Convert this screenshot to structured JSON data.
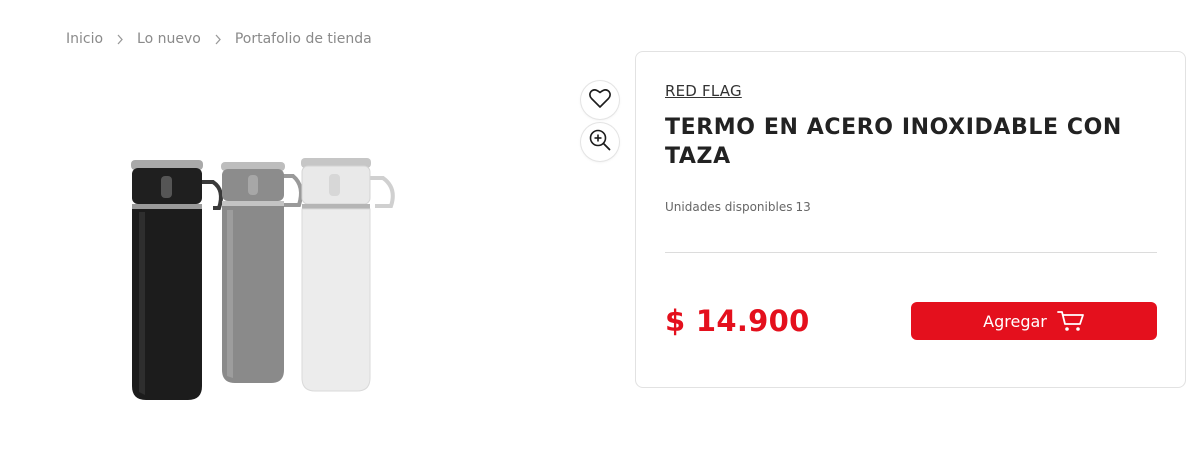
{
  "breadcrumb": {
    "items": [
      "Inicio",
      "Lo nuevo",
      "Portafolio de tienda"
    ]
  },
  "product": {
    "brand": "RED FLAG",
    "title": "TERMO EN ACERO INOXIDABLE CON TAZA",
    "stock_label": "Unidades disponibles",
    "stock_count": "13",
    "price": "$ 14.900",
    "add_label": "Agregar",
    "thermos_colors": [
      "#1f1f1f",
      "#8c8c8c",
      "#ececec"
    ]
  },
  "icons": {
    "favorite": "heart-icon",
    "zoom": "zoom-in-icon",
    "cart": "cart-icon",
    "breadcrumb_separator": "chevron-right-icon"
  },
  "colors": {
    "accent": "#e4101d",
    "border": "#e2e2e2",
    "muted_text": "#8a8a8a"
  }
}
